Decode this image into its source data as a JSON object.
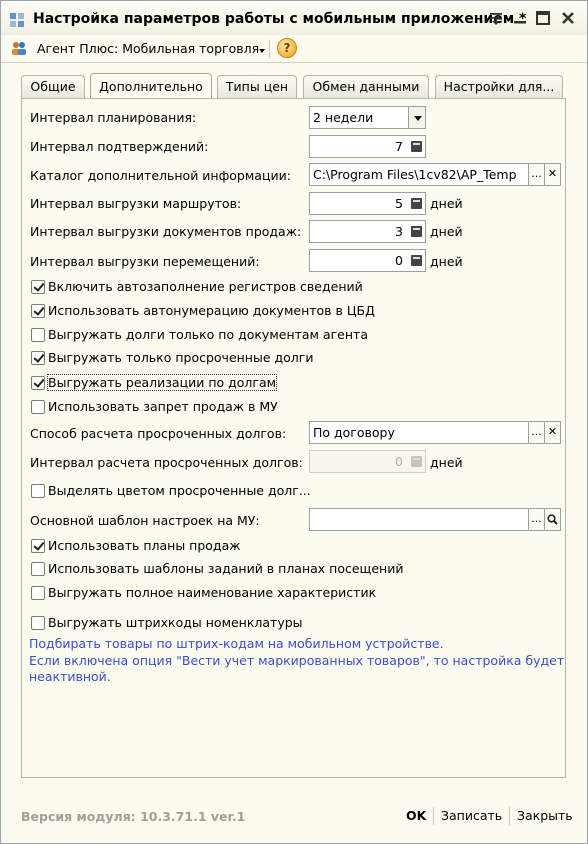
{
  "window": {
    "title": "Настройка параметров работы с мобильным приложением *",
    "icon": "app-grid-icon",
    "controls": [
      "menu-icon",
      "minimize-icon",
      "maximize-icon",
      "close-icon"
    ]
  },
  "toolbar": {
    "menu_label": "Агент Плюс: Мобильная торговля",
    "help_label": "?"
  },
  "tabs": [
    {
      "label": "Общие",
      "active": false
    },
    {
      "label": "Дополнительно",
      "active": true
    },
    {
      "label": "Типы цен",
      "active": false
    },
    {
      "label": "Обмен данными",
      "active": false
    },
    {
      "label": "Настройки для...",
      "active": false
    }
  ],
  "form": {
    "planning_interval": {
      "label": "Интервал планирования:",
      "value": "2 недели"
    },
    "confirmation_interval": {
      "label": "Интервал подтверждений:",
      "value": "7"
    },
    "catalog": {
      "label": "Каталог дополнительной информации:",
      "value": "C:\\Program Files\\1cv82\\AP_Temp"
    },
    "routes_interval": {
      "label": "Интервал выгрузки маршрутов:",
      "value": "5",
      "unit": "дней"
    },
    "sales_docs_interval": {
      "label": "Интервал выгрузки документов продаж:",
      "value": "3",
      "unit": "дней"
    },
    "transfers_interval": {
      "label": "Интервал выгрузки перемещений:",
      "value": "0",
      "unit": "дней"
    },
    "checkboxes": [
      {
        "label": "Включить автозаполнение регистров сведений",
        "checked": true
      },
      {
        "label": "Использовать автонумерацию документов в ЦБД",
        "checked": true
      },
      {
        "label": "Выгружать долги только по документам агента",
        "checked": false
      },
      {
        "label": "Выгружать только просроченные долги",
        "checked": true
      },
      {
        "label": "Выгружать реализации по долгам",
        "checked": true
      },
      {
        "label": "Использовать запрет продаж в МУ",
        "checked": false
      }
    ],
    "overdue_method": {
      "label": "Способ расчета просроченных долгов:",
      "value": "По договору"
    },
    "overdue_interval": {
      "label": "Интервал расчета просроченных долгов:",
      "value": "0",
      "unit": "дней"
    },
    "highlight_overdue": {
      "label": "Выделять цветом просроченные долг...",
      "checked": false
    },
    "template": {
      "label": "Основной шаблон настроек на МУ:",
      "value": ""
    },
    "checkboxes2": [
      {
        "label": "Использовать планы продаж",
        "checked": true
      },
      {
        "label": "Использовать шаблоны заданий в планах посещений",
        "checked": false
      },
      {
        "label": "Выгружать полное наименование характеристик",
        "checked": false
      },
      {
        "label": "Выгружать штрихкоды номенклатуры",
        "checked": false
      }
    ],
    "info_lines": [
      "Подбирать товары по штрих-кодам на мобильном устройстве.",
      "Если включена опция \"Вести учет маркированных товаров\", то настройка будет",
      "неактивной."
    ]
  },
  "footer": {
    "version": "Версия модуля: 10.3.71.1 ver.1",
    "ok": "OK",
    "save": "Записать",
    "close": "Закрыть"
  },
  "colors": {
    "info_text": "#3a4fc7",
    "window_bg": "#fbfbf0",
    "version_text": "#a0a098"
  }
}
